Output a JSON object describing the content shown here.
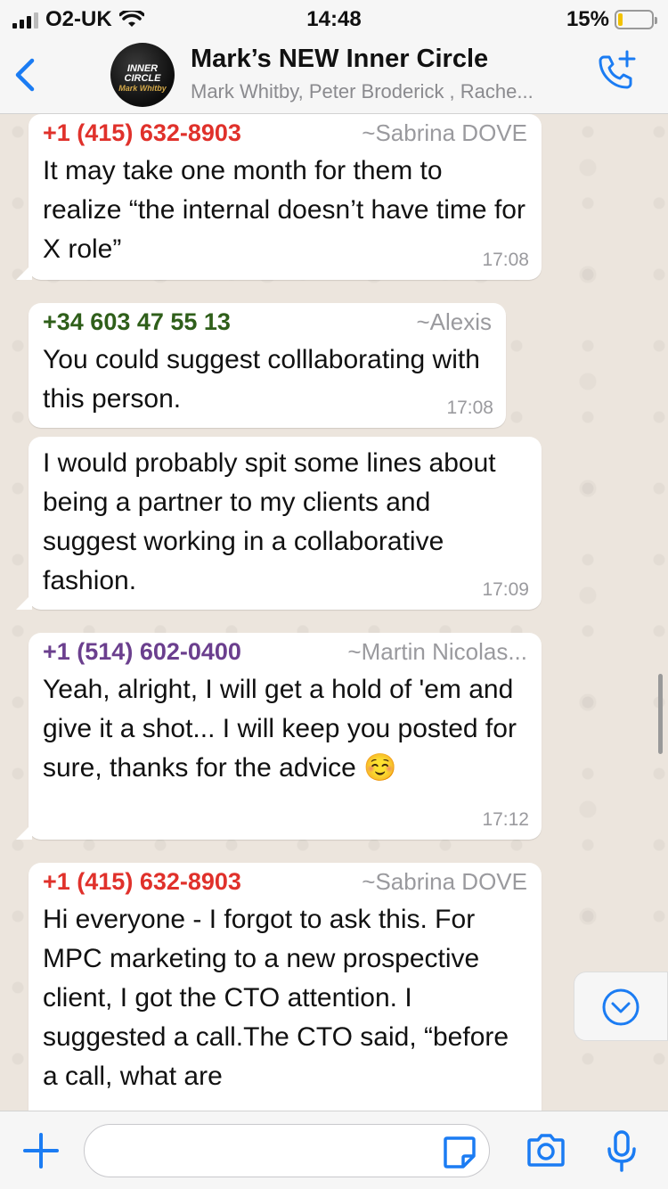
{
  "status_bar": {
    "carrier": "O2-UK",
    "time": "14:48",
    "battery": "15%",
    "battery_level": 0.15
  },
  "header": {
    "title": "Mark’s NEW Inner Circle",
    "members": "Mark Whitby, Peter Broderick , Rache...",
    "avatar_text_line1": "INNER",
    "avatar_text_line2": "CIRCLE",
    "avatar_signature": "Mark Whitby"
  },
  "messages": [
    {
      "phone": "+1 (415) 632-8903",
      "name": "~Sabrina DOVE",
      "color": "#e0312b",
      "text": "It may take one month for them to realize “the internal doesn’t have time for X role”",
      "time": "17:08"
    },
    {
      "phone": "+34 603 47 55 13",
      "name": "~Alexis",
      "color": "#2f5f1a",
      "text": "You could suggest colllaborating with this person.",
      "time": "17:08"
    },
    {
      "text": "I would probably spit some lines about being a partner to my clients and suggest working in a collaborative fashion.",
      "time": "17:09"
    },
    {
      "phone": "+1 (514) 602-0400",
      "name": "~Martin Nicolas...",
      "color": "#6b3f8e",
      "text": "Yeah, alright, I will get a hold of 'em and give it a shot... I will keep you posted for sure, thanks for the advice ☺️",
      "time": "17:12"
    },
    {
      "phone": "+1 (415) 632-8903",
      "name": "~Sabrina DOVE",
      "color": "#e0312b",
      "text": "Hi everyone - I forgot to ask this. For MPC marketing to a new prospective client, I got the CTO attention. I suggested a call.The CTO said, “before a call, what are",
      "time": ""
    }
  ],
  "input": {
    "placeholder": "",
    "value": ""
  },
  "colors": {
    "accent": "#1b7cf3",
    "bubble": "#ffffff",
    "chat_bg": "#ece5dd"
  }
}
